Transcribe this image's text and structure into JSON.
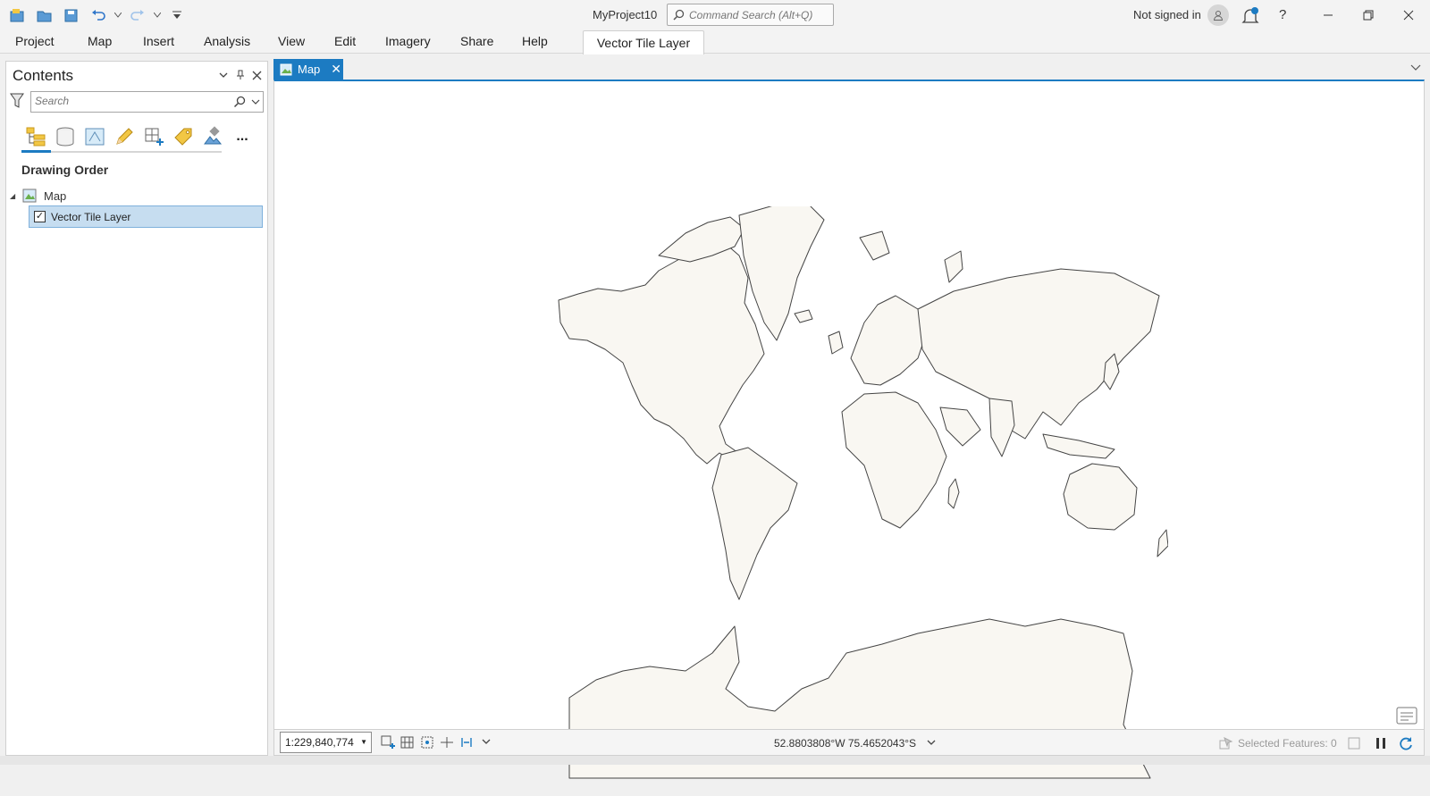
{
  "app": {
    "project_title": "MyProject10",
    "command_search_placeholder": "Command Search (Alt+Q)",
    "sign_in_status": "Not signed in",
    "help_label": "?"
  },
  "ribbon": {
    "tabs": [
      "Project",
      "Map",
      "Insert",
      "Analysis",
      "View",
      "Edit",
      "Imagery",
      "Share",
      "Help"
    ],
    "contextual_tab": "Vector Tile Layer"
  },
  "contents_pane": {
    "title": "Contents",
    "search_placeholder": "Search",
    "section_title": "Drawing Order",
    "map_item": "Map",
    "layer_item": "Vector Tile Layer",
    "layer_checked": true,
    "more_label": "..."
  },
  "map_view": {
    "tab_label": "Map",
    "scale": "1:229,840,774",
    "coordinates": "52.8803808°W 75.4652043°S",
    "selected_features": "Selected Features: 0"
  },
  "colors": {
    "accent": "#1c7bc2",
    "land_fill": "#f9f7f2",
    "land_outline": "#444444",
    "selection": "#c6ddf0"
  }
}
